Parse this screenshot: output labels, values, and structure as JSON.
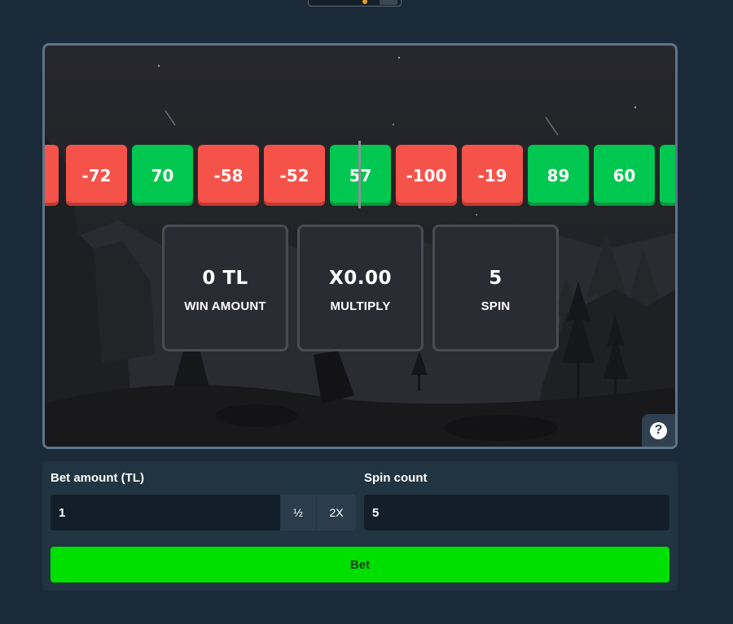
{
  "reel": {
    "tiles": [
      {
        "value": "-",
        "color": "red"
      },
      {
        "value": "-72",
        "color": "red"
      },
      {
        "value": "70",
        "color": "green"
      },
      {
        "value": "-58",
        "color": "red"
      },
      {
        "value": "-52",
        "color": "red"
      },
      {
        "value": "57",
        "color": "green"
      },
      {
        "value": "-100",
        "color": "red"
      },
      {
        "value": "-19",
        "color": "red"
      },
      {
        "value": "89",
        "color": "green"
      },
      {
        "value": "60",
        "color": "green"
      },
      {
        "value": "",
        "color": "green"
      }
    ]
  },
  "stats": {
    "win_amount": {
      "value": "0 TL",
      "label": "WIN AMOUNT"
    },
    "multiply": {
      "value": "X0.00",
      "label": "MULTIPLY"
    },
    "spin": {
      "value": "5",
      "label": "SPIN"
    }
  },
  "help": {
    "icon": "question-icon",
    "symbol": "?"
  },
  "bet_form": {
    "bet_amount_label": "Bet amount (TL)",
    "bet_amount_value": "1",
    "half_label": "½",
    "double_label": "2X",
    "spin_count_label": "Spin count",
    "spin_count_value": "5",
    "bet_button_label": "Bet"
  },
  "colors": {
    "red_tile": "#f5534a",
    "green_tile": "#00c750",
    "bet_button": "#00e000",
    "background": "#1b2a38"
  }
}
